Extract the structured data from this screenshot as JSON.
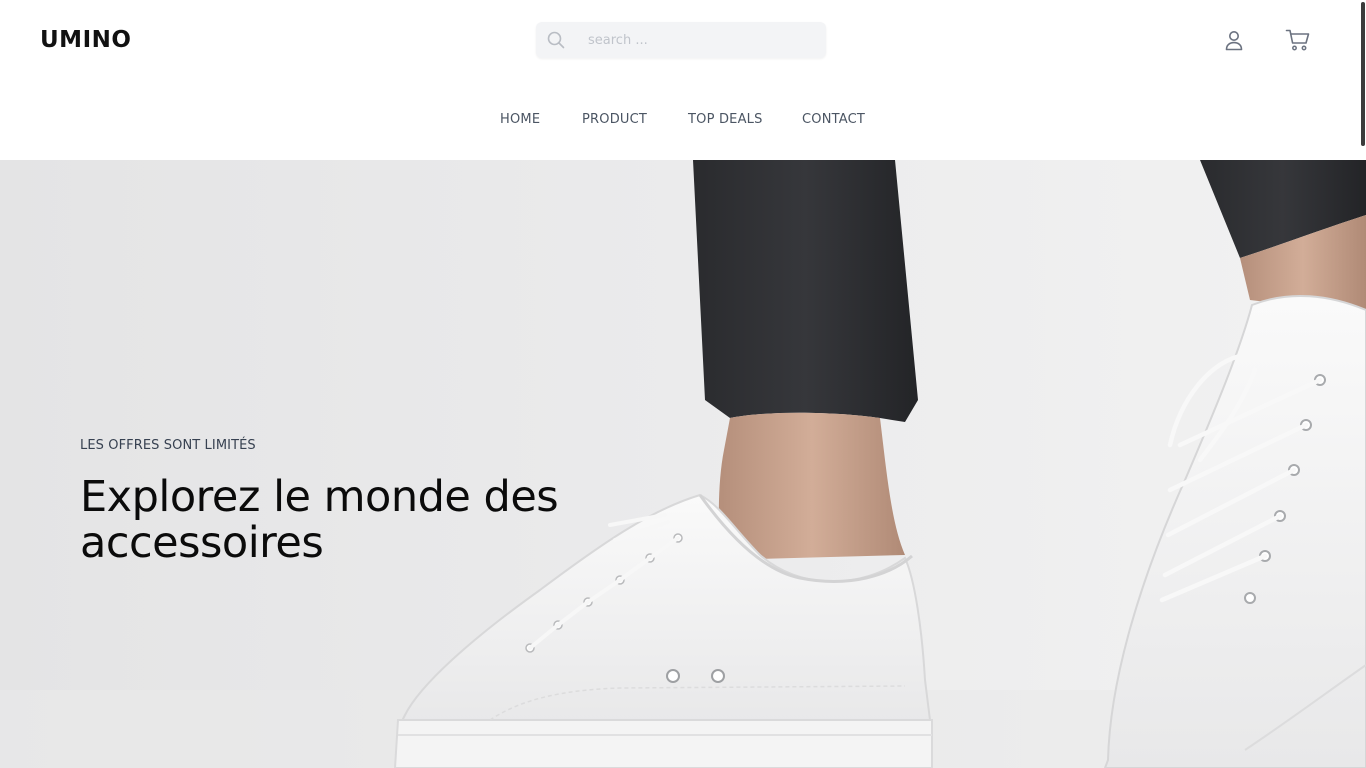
{
  "brand": {
    "logo_text": "UMINO"
  },
  "search": {
    "placeholder": "search ..."
  },
  "header_icons": {
    "user": "user-icon",
    "cart": "cart-icon",
    "search": "search-icon"
  },
  "nav": {
    "items": [
      {
        "label": "HOME"
      },
      {
        "label": "PRODUCT"
      },
      {
        "label": "TOP DEALS"
      },
      {
        "label": "CONTACT"
      }
    ]
  },
  "hero": {
    "eyebrow": "LES OFFRES SONT LIMITÉS",
    "title": "Explorez le monde des accessoires"
  },
  "colors": {
    "text_dark": "#0b0b0b",
    "nav_text": "#4b5563",
    "search_bg": "#f3f4f6",
    "hero_bg": "#ebebec"
  }
}
